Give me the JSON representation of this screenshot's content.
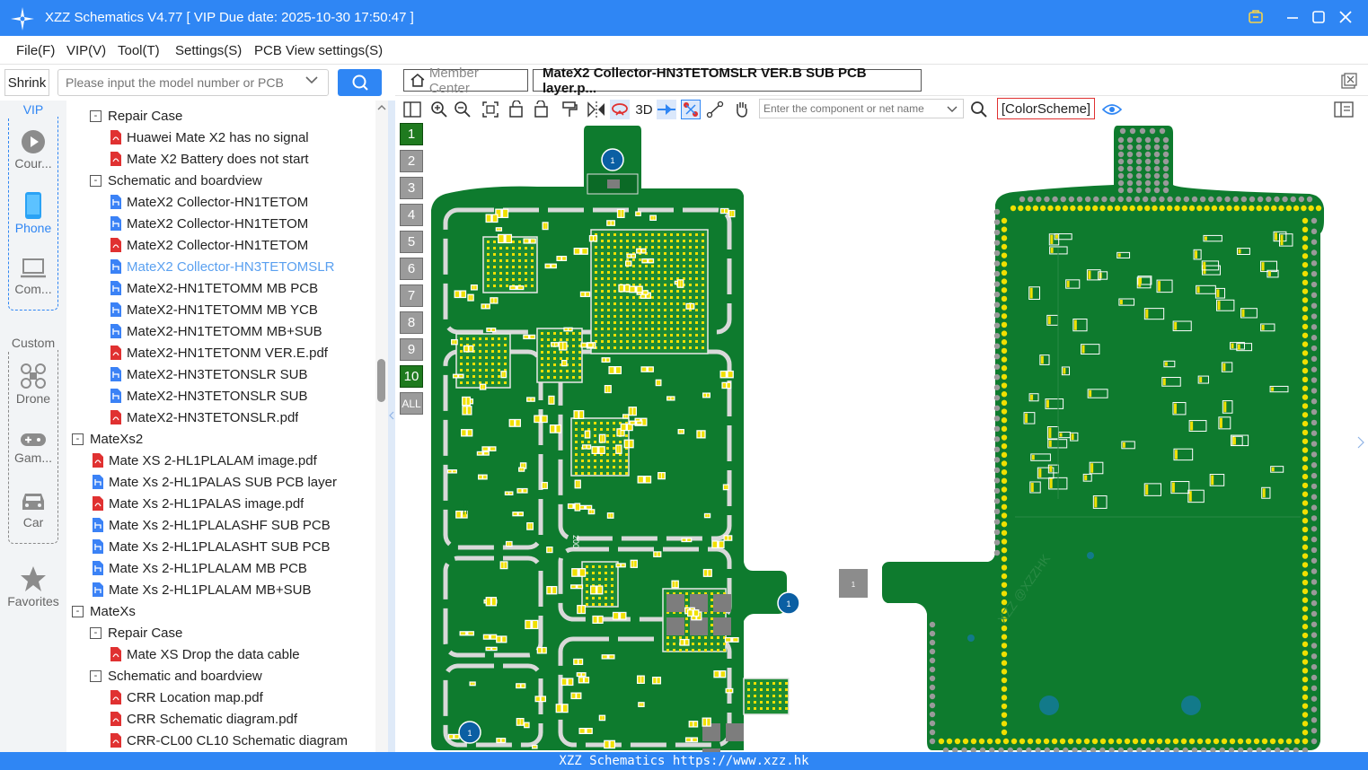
{
  "window": {
    "title": "XZZ Schematics V4.77 [ VIP Due date: 2025-10-30 17:50:47 ]"
  },
  "menu": [
    "File(F)",
    "VIP(V)",
    "Tool(T)",
    "Settings(S)",
    "PCB View settings(S)"
  ],
  "search": {
    "shrink_label": "Shrink",
    "placeholder": "Please input the model number or PCB"
  },
  "leftnav": {
    "vip_label": "VIP",
    "custom_label": "Custom",
    "items": [
      {
        "label": "Cour...",
        "icon": "play-icon"
      },
      {
        "label": "Phone",
        "icon": "phone-icon"
      },
      {
        "label": "Com...",
        "icon": "laptop-icon"
      },
      {
        "label": "Drone",
        "icon": "drone-icon"
      },
      {
        "label": "Gam...",
        "icon": "gamepad-icon"
      },
      {
        "label": "Car",
        "icon": "car-icon"
      },
      {
        "label": "Favorites",
        "icon": "star-icon"
      }
    ]
  },
  "tree": [
    {
      "level": 2,
      "toggle": "-",
      "icon": "none",
      "label": "Repair Case"
    },
    {
      "level": 3,
      "toggle": "",
      "icon": "pdf",
      "label": "Huawei Mate X2 has no signal"
    },
    {
      "level": 3,
      "toggle": "",
      "icon": "pdf",
      "label": "Mate X2 Battery does not start"
    },
    {
      "level": 2,
      "toggle": "-",
      "icon": "none",
      "label": "Schematic and boardview"
    },
    {
      "level": 3,
      "toggle": "",
      "icon": "pcb",
      "label": "MateX2 Collector-HN1TETOM"
    },
    {
      "level": 3,
      "toggle": "",
      "icon": "pcb",
      "label": "MateX2 Collector-HN1TETOM"
    },
    {
      "level": 3,
      "toggle": "",
      "icon": "pdf",
      "label": "MateX2 Collector-HN1TETOM"
    },
    {
      "level": 3,
      "toggle": "",
      "icon": "pcb",
      "label": "MateX2 Collector-HN3TETOMSLR",
      "selected": true
    },
    {
      "level": 3,
      "toggle": "",
      "icon": "pcb",
      "label": "MateX2-HN1TETOMM MB PCB"
    },
    {
      "level": 3,
      "toggle": "",
      "icon": "pcb",
      "label": "MateX2-HN1TETOMM MB YCB"
    },
    {
      "level": 3,
      "toggle": "",
      "icon": "pcb",
      "label": "MateX2-HN1TETOMM MB+SUB"
    },
    {
      "level": 3,
      "toggle": "",
      "icon": "pdf",
      "label": "MateX2-HN1TETONM VER.E.pdf"
    },
    {
      "level": 3,
      "toggle": "",
      "icon": "pcb",
      "label": "MateX2-HN3TETONSLR SUB"
    },
    {
      "level": 3,
      "toggle": "",
      "icon": "pcb",
      "label": "MateX2-HN3TETONSLR SUB"
    },
    {
      "level": 3,
      "toggle": "",
      "icon": "pdf",
      "label": "MateX2-HN3TETONSLR.pdf"
    },
    {
      "level": 1,
      "toggle": "-",
      "icon": "none",
      "label": "MateXs2"
    },
    {
      "level": 2,
      "toggle": "",
      "icon": "pdf",
      "label": "Mate XS 2-HL1PLALAM image.pdf"
    },
    {
      "level": 2,
      "toggle": "",
      "icon": "pcb",
      "label": "Mate Xs 2-HL1PALAS SUB PCB layer"
    },
    {
      "level": 2,
      "toggle": "",
      "icon": "pdf",
      "label": "Mate Xs 2-HL1PALAS image.pdf"
    },
    {
      "level": 2,
      "toggle": "",
      "icon": "pcb",
      "label": "Mate Xs 2-HL1PLALASHF SUB PCB"
    },
    {
      "level": 2,
      "toggle": "",
      "icon": "pcb",
      "label": "Mate Xs 2-HL1PLALASHT SUB PCB"
    },
    {
      "level": 2,
      "toggle": "",
      "icon": "pcb",
      "label": "Mate Xs 2-HL1PLALAM MB PCB"
    },
    {
      "level": 2,
      "toggle": "",
      "icon": "pcb",
      "label": "Mate Xs 2-HL1PLALAM MB+SUB"
    },
    {
      "level": 1,
      "toggle": "-",
      "icon": "none",
      "label": "MateXs"
    },
    {
      "level": 2,
      "toggle": "-",
      "icon": "none",
      "label": "Repair Case"
    },
    {
      "level": 3,
      "toggle": "",
      "icon": "pdf",
      "label": "Mate XS Drop the data cable"
    },
    {
      "level": 2,
      "toggle": "-",
      "icon": "none",
      "label": "Schematic and boardview"
    },
    {
      "level": 3,
      "toggle": "",
      "icon": "pdf",
      "label": "CRR Location map.pdf"
    },
    {
      "level": 3,
      "toggle": "",
      "icon": "pdf",
      "label": "CRR Schematic diagram.pdf"
    },
    {
      "level": 3,
      "toggle": "",
      "icon": "pdf",
      "label": "CRR-CL00 CL10 Schematic diagram"
    }
  ],
  "tabs": {
    "member_center": "Member Center",
    "active": "MateX2 Collector-HN3TETOMSLR VER.B SUB PCB layer.p..."
  },
  "toolbar": {
    "label_3d": "3D",
    "component_placeholder": "Enter the component or net name",
    "colorscheme": "[ColorScheme]"
  },
  "layers": [
    "1",
    "2",
    "3",
    "4",
    "5",
    "6",
    "7",
    "8",
    "9",
    "10",
    "ALL"
  ],
  "board": {
    "marks": [
      "1",
      "1",
      "1",
      "1"
    ],
    "chip_labels": [
      "05E",
      "200"
    ],
    "watermark": "XZZ @XZZHK"
  },
  "colors": {
    "accent": "#2f86f4",
    "pcb_green": "#0e7b2e",
    "pad_yellow": "#f0e000",
    "silk_gray": "#d9d9d9"
  },
  "status": "XZZ Schematics https://www.xzz.hk"
}
